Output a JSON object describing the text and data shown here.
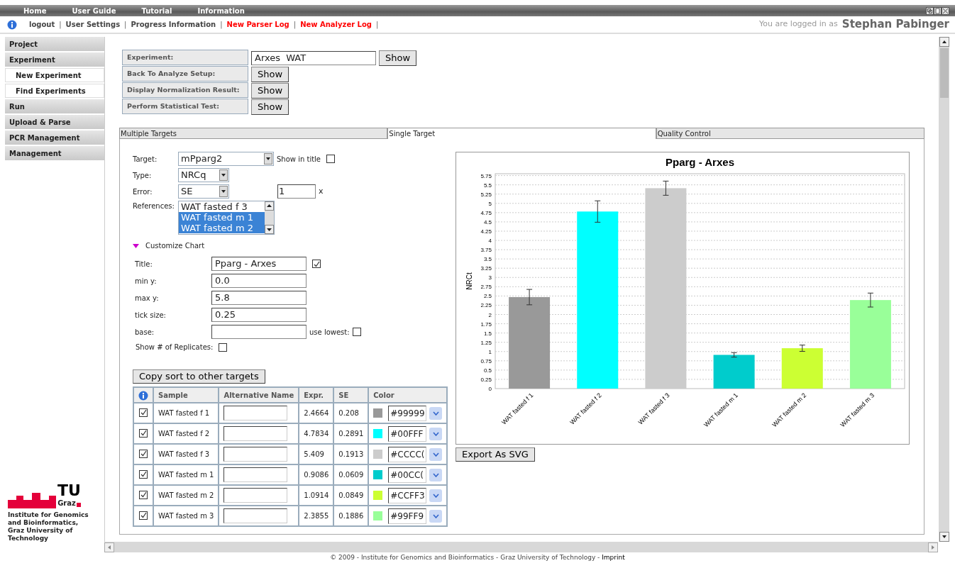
{
  "top_menu": [
    "Home",
    "User Guide",
    "Tutorial",
    "Information"
  ],
  "link_bar": {
    "links": [
      {
        "label": "logout",
        "highlight": false
      },
      {
        "label": "User Settings",
        "highlight": false
      },
      {
        "label": "Progress Information",
        "highlight": false
      },
      {
        "label": "New Parser Log",
        "highlight": true
      },
      {
        "label": "New Analyzer Log",
        "highlight": true
      }
    ],
    "separator": "|"
  },
  "login": {
    "prefix": "You are logged in as",
    "user": "Stephan Pabinger"
  },
  "sidebar": {
    "items": [
      {
        "label": "Project",
        "kind": "section"
      },
      {
        "label": "Experiment",
        "kind": "section"
      },
      {
        "label": "New Experiment",
        "kind": "subitem"
      },
      {
        "label": "Find Experiments",
        "kind": "subitem"
      },
      {
        "label": "Run",
        "kind": "section"
      },
      {
        "label": "Upload & Parse",
        "kind": "section"
      },
      {
        "label": "PCR Management",
        "kind": "section"
      },
      {
        "label": "Management",
        "kind": "section"
      }
    ]
  },
  "logo": {
    "mark": "TU",
    "sub": "Graz",
    "caption": "Institute for Genomics and Bioinformatics, Graz University of Technology"
  },
  "actions": [
    {
      "label": "Experiment:",
      "value": "Arxes  WAT",
      "button": "Show"
    },
    {
      "label": "Back To Analyze Setup:",
      "button": "Show"
    },
    {
      "label": "Display Normalization Result:",
      "button": "Show"
    },
    {
      "label": "Perform Statistical Test:",
      "button": "Show"
    }
  ],
  "tabs": [
    {
      "label": "Multiple Targets",
      "selected": false
    },
    {
      "label": "Single Target",
      "selected": true
    },
    {
      "label": "Quality Control",
      "selected": false
    }
  ],
  "settings": {
    "target": {
      "label": "Target:",
      "value": "mPparg2"
    },
    "show_in_title": {
      "label": "Show in title",
      "checked": false
    },
    "type": {
      "label": "Type:",
      "value": "NRCq"
    },
    "error": {
      "label": "Error:",
      "value": "SE"
    },
    "error_factor": {
      "value": "1",
      "unit": "x"
    },
    "references": {
      "label": "References:",
      "options": [
        {
          "label": "WAT fasted f 3",
          "selected": false
        },
        {
          "label": "WAT fasted m 1",
          "selected": true
        },
        {
          "label": "WAT fasted m 2",
          "selected": true
        }
      ]
    }
  },
  "customize": {
    "label": "Customize Chart",
    "expanded": true,
    "fields": [
      {
        "label": "Title:",
        "value": "Pparg - Arxes",
        "check": {
          "checked": true
        }
      },
      {
        "label": "min y:",
        "value": "0.0"
      },
      {
        "label": "max y:",
        "value": "5.8"
      },
      {
        "label": "tick size:",
        "value": "0.25"
      },
      {
        "label": "base:",
        "check": {
          "label": "use lowest:",
          "checked": false
        }
      }
    ],
    "replicates": {
      "label": "Show # of Replicates:",
      "checked": false
    }
  },
  "copy_button": "Copy sort to other targets",
  "samples": {
    "columns": [
      "Sample",
      "Alternative Name",
      "Expr.",
      "SE",
      "Color"
    ],
    "rows": [
      {
        "checked": true,
        "sample": "WAT fasted f 1",
        "expr": "2.4664",
        "se": "0.208",
        "color": "#999999",
        "color_text": "#99999"
      },
      {
        "checked": true,
        "sample": "WAT fasted f 2",
        "expr": "4.7834",
        "se": "0.2891",
        "color": "#00ffff",
        "color_text": "#00FFF"
      },
      {
        "checked": true,
        "sample": "WAT fasted f 3",
        "expr": "5.409",
        "se": "0.1913",
        "color": "#cccccc",
        "color_text": "#CCCC("
      },
      {
        "checked": true,
        "sample": "WAT fasted m 1",
        "expr": "0.9086",
        "se": "0.0609",
        "color": "#00cccc",
        "color_text": "#00CC("
      },
      {
        "checked": true,
        "sample": "WAT fasted m 2",
        "expr": "1.0914",
        "se": "0.0849",
        "color": "#ccff33",
        "color_text": "#CCFF3"
      },
      {
        "checked": true,
        "sample": "WAT fasted m 3",
        "expr": "2.3855",
        "se": "0.1886",
        "color": "#99ff99",
        "color_text": "#99FF9"
      }
    ]
  },
  "chart": {
    "chart_data": {
      "type": "bar",
      "title": "Pparg - Arxes",
      "ylabel": "NRCt",
      "categories": [
        "WAT fasted f 1",
        "WAT fasted f 2",
        "WAT fasted f 3",
        "WAT fasted m 1",
        "WAT fasted m 2",
        "WAT fasted m 3"
      ],
      "series": [
        {
          "values": [
            2.47,
            4.78,
            5.41,
            0.91,
            1.09,
            2.39
          ]
        }
      ],
      "grid": true,
      "ylim": [
        0,
        5.8
      ],
      "yticks": [
        0,
        0.25,
        0.5,
        0.75,
        1,
        1.25,
        1.5,
        1.75,
        2,
        2.25,
        2.5,
        2.75,
        3,
        3.25,
        3.5,
        3.75,
        4,
        4.25,
        4.5,
        4.75,
        5,
        5.25,
        5.5,
        5.75
      ]
    }
  },
  "export_button": "Export As SVG",
  "footer": {
    "text": "© 2009 - Institute for Genomics and Bioinformatics - Graz University of Technology - ",
    "link": "Imprint"
  }
}
